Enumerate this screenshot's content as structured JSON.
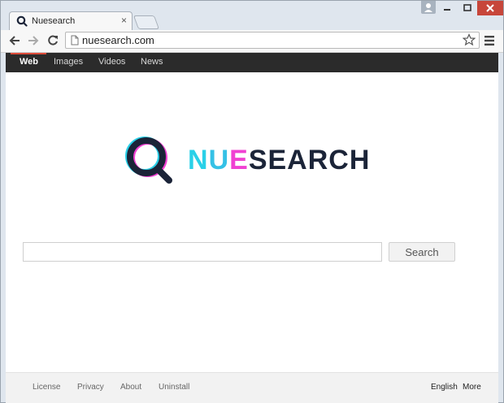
{
  "browser": {
    "tab_title": "Nuesearch",
    "tab_close": "×",
    "url": "nuesearch.com",
    "icons": [
      "back-arrow-icon",
      "forward-arrow-icon",
      "reload-icon",
      "page-icon",
      "star-icon",
      "menu-icon",
      "user-icon",
      "minimize-icon",
      "maximize-icon",
      "close-icon"
    ]
  },
  "navbar": {
    "items": [
      "Web",
      "Images",
      "Videos",
      "News"
    ],
    "active": "Web"
  },
  "logo": {
    "letters": [
      "N",
      "U",
      "E",
      "SEARCH"
    ],
    "colors": {
      "n": "#2ad0e8",
      "u": "#35c1e6",
      "e": "#f040d2",
      "rest": "#1b2438",
      "q_ring": "#1b2438"
    }
  },
  "search": {
    "value": "",
    "button_label": "Search"
  },
  "footer": {
    "links": [
      "License",
      "Privacy",
      "About",
      "Uninstall"
    ],
    "language": "English",
    "more": "More"
  }
}
